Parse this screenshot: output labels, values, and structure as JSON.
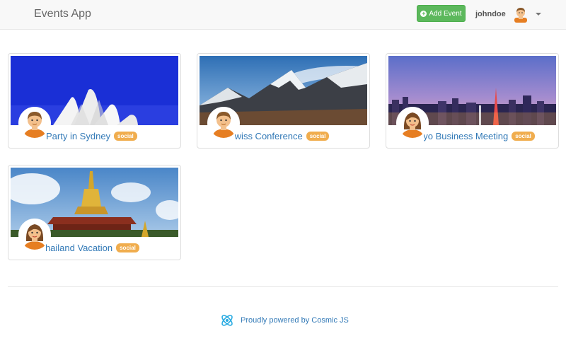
{
  "navbar": {
    "brand": "Events App",
    "add_event_label": "Add Event",
    "username": "johndoe",
    "icons": [
      "plus-circle-icon",
      "user-avatar-icon",
      "caret-down-icon"
    ]
  },
  "events": [
    {
      "title": "Party in Sydney",
      "tag": "social",
      "image": "sydney-opera-house",
      "avatar": "male"
    },
    {
      "title": "Swiss Conference",
      "tag": "social",
      "image": "swiss-alps",
      "avatar": "male"
    },
    {
      "title": "Tokyo Business Meeting",
      "tag": "social",
      "image": "tokyo-skyline",
      "avatar": "female"
    },
    {
      "title": "Thailand Vacation",
      "tag": "social",
      "image": "thai-temple",
      "avatar": "female"
    }
  ],
  "footer": {
    "text": "Proudly powered by Cosmic JS",
    "logo": "cosmic-js-logo"
  },
  "colors": {
    "navbar_bg": "#f8f8f8",
    "success": "#5cb85c",
    "link": "#337ab7",
    "badge": "#f0ad4e"
  }
}
